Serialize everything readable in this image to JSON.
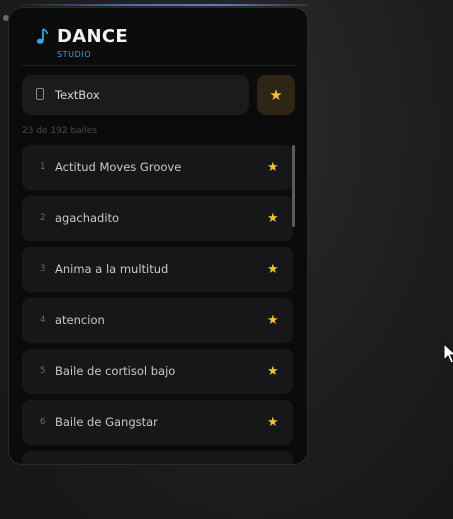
{
  "header": {
    "title": "DANCE",
    "subtitle": "STUDIO",
    "icon": "music-note-icon"
  },
  "search": {
    "value": "TextBox",
    "placeholder": "",
    "icon": "phone-icon"
  },
  "favorites_button": {
    "icon": "star-icon",
    "glyph": "★"
  },
  "list": {
    "count_label": "23 de 192 bailes",
    "items": [
      {
        "num": "1",
        "name": "Actitud Moves Groove",
        "star": "★"
      },
      {
        "num": "2",
        "name": "agachadito",
        "star": "★"
      },
      {
        "num": "3",
        "name": "Anima a la multitud",
        "star": "★"
      },
      {
        "num": "4",
        "name": "atencion",
        "star": "★"
      },
      {
        "num": "5",
        "name": "Baile de cortisol bajo",
        "star": "★"
      },
      {
        "num": "6",
        "name": "Baile de Gangstar",
        "star": "★"
      }
    ]
  },
  "colors": {
    "accent": "#3aa0e8",
    "star": "#f4bf3a",
    "panel": "#0b0b0c",
    "item": "#171719"
  }
}
